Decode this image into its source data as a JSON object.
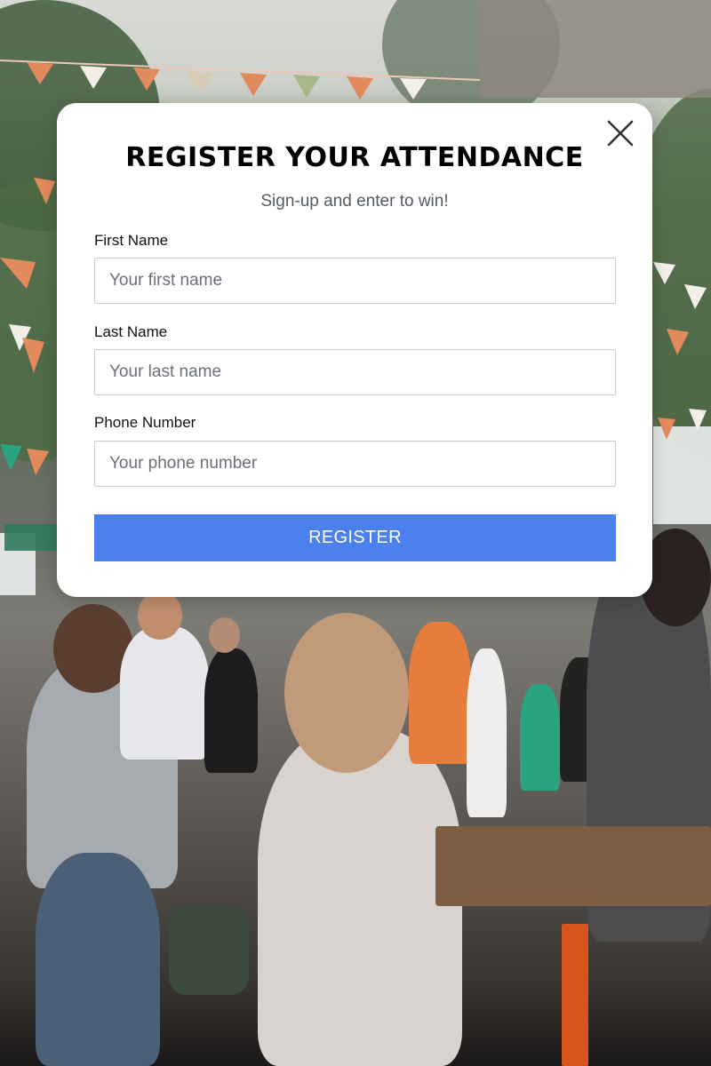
{
  "modal": {
    "title": "REGISTER YOUR ATTENDANCE",
    "subtitle": "Sign-up and enter to win!",
    "close_icon": "close-icon"
  },
  "form": {
    "first_name": {
      "label": "First Name",
      "placeholder": "Your first name",
      "value": ""
    },
    "last_name": {
      "label": "Last Name",
      "placeholder": "Your last name",
      "value": ""
    },
    "phone": {
      "label": "Phone Number",
      "placeholder": "Your phone number",
      "value": ""
    },
    "submit_label": "REGISTER"
  },
  "colors": {
    "button": "#4b80ee",
    "title": "#000000",
    "subtitle": "#555b63"
  }
}
